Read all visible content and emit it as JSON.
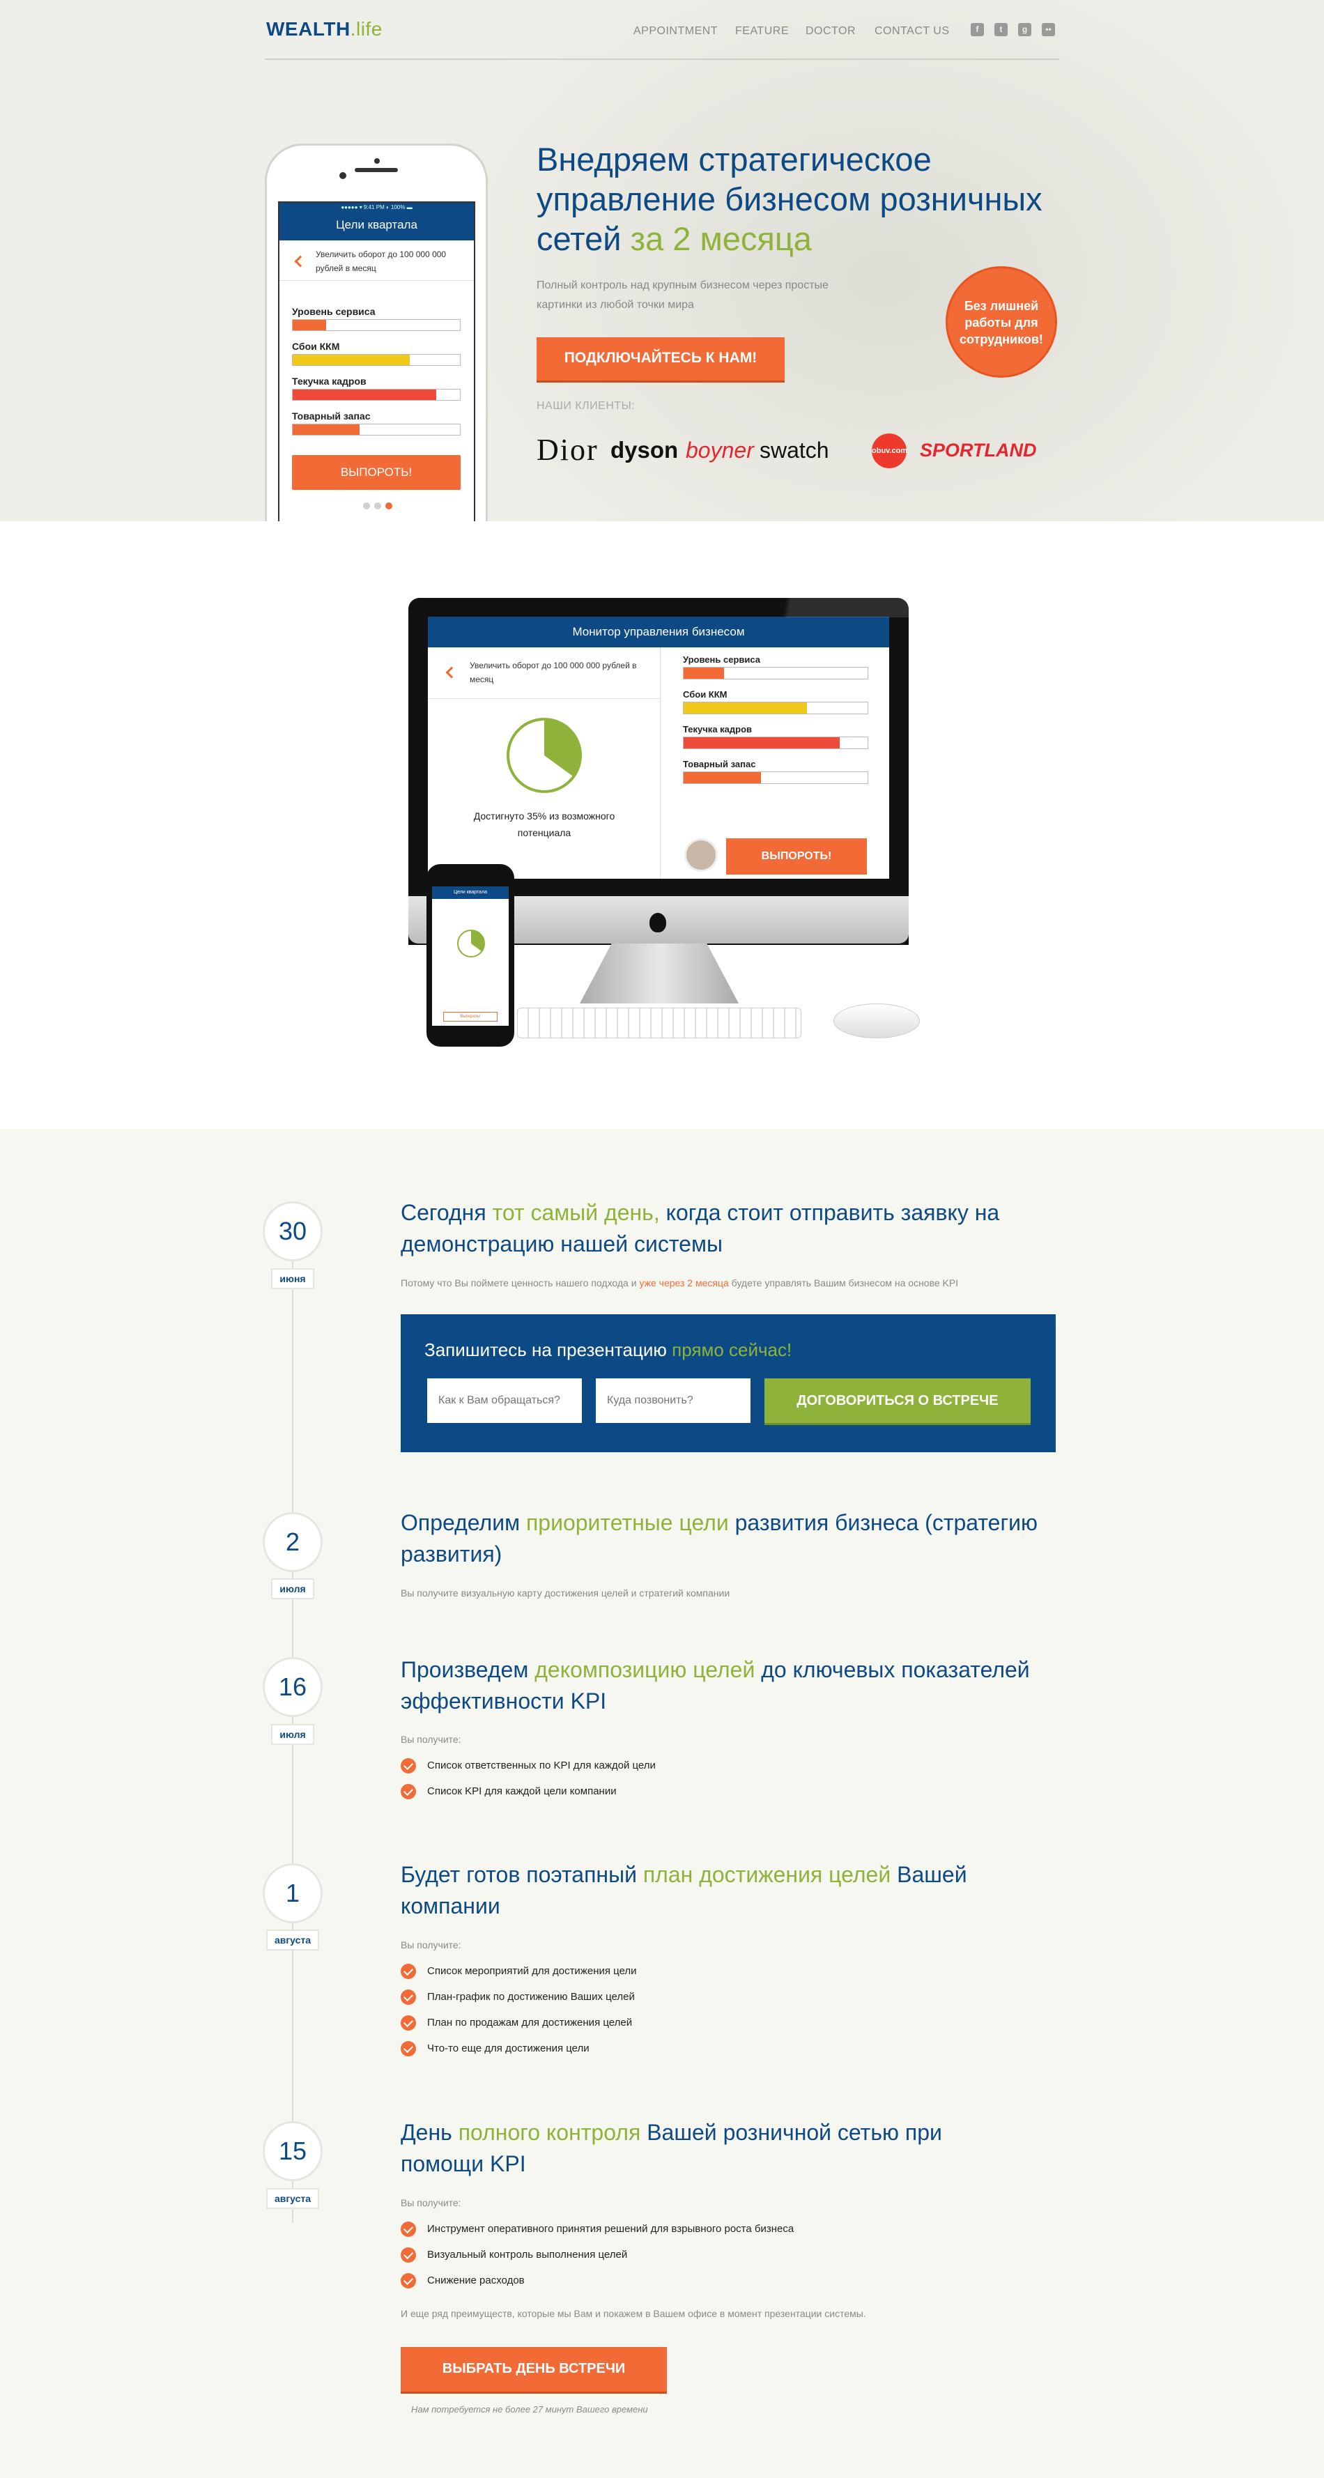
{
  "header": {
    "logo_main": "WEALTH",
    "logo_dot": ".life",
    "nav": [
      "APPOINTMENT",
      "FEATURE",
      "DOCTOR",
      "CONTACT US"
    ]
  },
  "phone": {
    "status": "●●●●● ▾   9:41 PM   ◐ 100% ▬",
    "title": "Цели квартала",
    "goal": "Увеличить оборот до 100 000 000 рублей в месяц",
    "bars": [
      {
        "label": "Уровень сервиса",
        "value": 0.2,
        "color": "#f26b36"
      },
      {
        "label": "Сбои ККМ",
        "value": 0.7,
        "color": "#f1c91a"
      },
      {
        "label": "Текучка кадров",
        "value": 0.86,
        "color": "#ee4b3a"
      },
      {
        "label": "Товарный запас",
        "value": 0.4,
        "color": "#f26b36"
      }
    ],
    "button": "ВЫПОРОТЬ!"
  },
  "hero": {
    "title_a": "Внедряем стратегическое управление бизнесом розничных сетей ",
    "title_b": "за 2 месяца",
    "subtitle": "Полный контроль над крупным бизнесом через простые картинки из любой точки мира",
    "cta": "ПОДКЛЮЧАЙТЕСЬ К НАМ!",
    "clients_label": "НАШИ КЛИЕНТЫ:",
    "clients": [
      "Dior",
      "dyson",
      "boyner",
      "swatch",
      "obuv.com",
      "SPORTLAND"
    ],
    "badge": "Без лишней работы для сотрудников!"
  },
  "monitor": {
    "title": "Монитор управления бизнесом",
    "goal": "Увеличить оборот до 100 000 000 рублей в месяц",
    "progress": 0.35,
    "achieved": "Достигнуто 35% из возможного потенциала",
    "bars": [
      {
        "label": "Уровень сервиса",
        "value": 0.22,
        "color": "#f26b36"
      },
      {
        "label": "Сбои ККМ",
        "value": 0.67,
        "color": "#f1c91a"
      },
      {
        "label": "Текучка кадров",
        "value": 0.85,
        "color": "#ee4b3a"
      },
      {
        "label": "Товарный запас",
        "value": 0.42,
        "color": "#f26b36"
      }
    ],
    "button": "ВЫПОРОТЬ!",
    "phone_title": "Цели квартала",
    "phone_button": "Выпороть!"
  },
  "timeline": [
    {
      "day": "30",
      "month": "июня",
      "t1": "Сегодня ",
      "t2": "тот самый день,",
      "t3": " когда стоит отправить заявку на демонстрацию нашей системы"
    },
    {
      "day": "2",
      "month": "июля",
      "t1": "Определим ",
      "t2": "приоритетные цели",
      "t3": " развития бизнеса (стратегию развития)"
    },
    {
      "day": "16",
      "month": "июля",
      "t1": "Произведем ",
      "t2": "декомпозицию целей",
      "t3": " до ключевых показателей эффективности KPI"
    },
    {
      "day": "1",
      "month": "августа",
      "t1": "Будет готов поэтапный ",
      "t2": "план достижения целей",
      "t3": " Вашей компании"
    },
    {
      "day": "15",
      "month": "августа",
      "t1": "День ",
      "t2": "полного контроля",
      "t3": " Вашей розничной сетью при помощи KPI"
    }
  ],
  "step1": {
    "note_a": "Потому что Вы поймете ценность нашего подхода и ",
    "note_b": "уже через 2 месяца",
    "note_c": " будете управлять Вашим бизнесом на основе KPI",
    "box_a": "Запишитесь на презентацию ",
    "box_b": "прямо сейчас!",
    "name_placeholder": "Как к Вам обращаться?",
    "phone_placeholder": "Куда позвонить?",
    "button": "ДОГОВОРИТЬСЯ О ВСТРЕЧЕ"
  },
  "step2": {
    "note": "Вы получите визуальную карту достижения целей и стратегий компании"
  },
  "step3": {
    "note": "Вы получите:",
    "items": [
      "Список ответственных по KPI для каждой цели",
      "Список KPI для каждой цели компании"
    ]
  },
  "step4": {
    "note": "Вы получите:",
    "items": [
      "Список мероприятий для достижения цели",
      "План-график по достижению Ваших целей",
      "План по продажам для достижения целей",
      "Что-то еще для достижения цели"
    ]
  },
  "step5": {
    "note": "Вы получите:",
    "items": [
      "Инструмент оперативного  принятия решений для взрывного роста бизнеса",
      "Визуальный контроль выполнения целей",
      "Снижение расходов"
    ],
    "extra": "И еще ряд преимуществ, которые мы Вам и покажем в Вашем офисе в момент презентации системы.",
    "button": "ВЫБРАТЬ ДЕНЬ ВСТРЕЧИ",
    "small": "Нам потребуется не более 27 минут Вашего времени"
  }
}
